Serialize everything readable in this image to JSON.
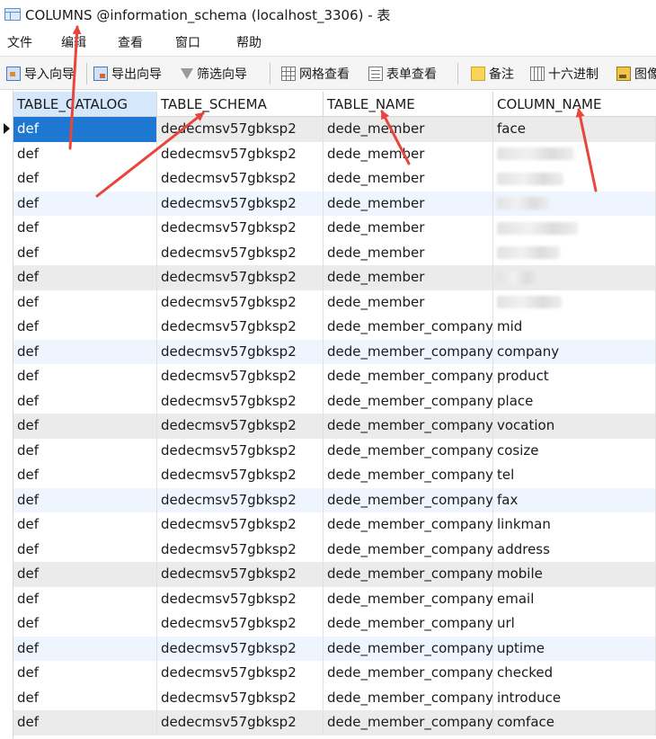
{
  "window": {
    "title": "COLUMNS @information_schema (localhost_3306) - 表",
    "icon": "table-icon"
  },
  "menu": [
    {
      "label": "文件"
    },
    {
      "label": "编辑"
    },
    {
      "label": "查看"
    },
    {
      "label": "窗口"
    },
    {
      "label": "帮助"
    }
  ],
  "toolbar": {
    "import_label": "导入向导",
    "export_label": "导出向导",
    "filter_label": "筛选向导",
    "grid_view_label": "网格查看",
    "form_view_label": "表单查看",
    "note_label": "备注",
    "hex_label": "十六进制",
    "image_label": "图像"
  },
  "columns": [
    "TABLE_CATALOG",
    "TABLE_SCHEMA",
    "TABLE_NAME",
    "COLUMN_NAME"
  ],
  "rows": [
    {
      "catalog": "def",
      "schema": "dedecmsv57gbksp2",
      "table": "dede_member",
      "column": "face"
    },
    {
      "catalog": "def",
      "schema": "dedecmsv57gbksp2",
      "table": "dede_member",
      "column": ""
    },
    {
      "catalog": "def",
      "schema": "dedecmsv57gbksp2",
      "table": "dede_member",
      "column": ""
    },
    {
      "catalog": "def",
      "schema": "dedecmsv57gbksp2",
      "table": "dede_member",
      "column": ""
    },
    {
      "catalog": "def",
      "schema": "dedecmsv57gbksp2",
      "table": "dede_member",
      "column": ""
    },
    {
      "catalog": "def",
      "schema": "dedecmsv57gbksp2",
      "table": "dede_member",
      "column": ""
    },
    {
      "catalog": "def",
      "schema": "dedecmsv57gbksp2",
      "table": "dede_member",
      "column": ""
    },
    {
      "catalog": "def",
      "schema": "dedecmsv57gbksp2",
      "table": "dede_member",
      "column": ""
    },
    {
      "catalog": "def",
      "schema": "dedecmsv57gbksp2",
      "table": "dede_member_company",
      "column": "mid"
    },
    {
      "catalog": "def",
      "schema": "dedecmsv57gbksp2",
      "table": "dede_member_company",
      "column": "company"
    },
    {
      "catalog": "def",
      "schema": "dedecmsv57gbksp2",
      "table": "dede_member_company",
      "column": "product"
    },
    {
      "catalog": "def",
      "schema": "dedecmsv57gbksp2",
      "table": "dede_member_company",
      "column": "place"
    },
    {
      "catalog": "def",
      "schema": "dedecmsv57gbksp2",
      "table": "dede_member_company",
      "column": "vocation"
    },
    {
      "catalog": "def",
      "schema": "dedecmsv57gbksp2",
      "table": "dede_member_company",
      "column": "cosize"
    },
    {
      "catalog": "def",
      "schema": "dedecmsv57gbksp2",
      "table": "dede_member_company",
      "column": "tel"
    },
    {
      "catalog": "def",
      "schema": "dedecmsv57gbksp2",
      "table": "dede_member_company",
      "column": "fax"
    },
    {
      "catalog": "def",
      "schema": "dedecmsv57gbksp2",
      "table": "dede_member_company",
      "column": "linkman"
    },
    {
      "catalog": "def",
      "schema": "dedecmsv57gbksp2",
      "table": "dede_member_company",
      "column": "address"
    },
    {
      "catalog": "def",
      "schema": "dedecmsv57gbksp2",
      "table": "dede_member_company",
      "column": "mobile"
    },
    {
      "catalog": "def",
      "schema": "dedecmsv57gbksp2",
      "table": "dede_member_company",
      "column": "email"
    },
    {
      "catalog": "def",
      "schema": "dedecmsv57gbksp2",
      "table": "dede_member_company",
      "column": "url"
    },
    {
      "catalog": "def",
      "schema": "dedecmsv57gbksp2",
      "table": "dede_member_company",
      "column": "uptime"
    },
    {
      "catalog": "def",
      "schema": "dedecmsv57gbksp2",
      "table": "dede_member_company",
      "column": "checked"
    },
    {
      "catalog": "def",
      "schema": "dedecmsv57gbksp2",
      "table": "dede_member_company",
      "column": "introduce"
    },
    {
      "catalog": "def",
      "schema": "dedecmsv57gbksp2",
      "table": "dede_member_company",
      "column": "comface"
    }
  ],
  "colors": {
    "selection": "#1e78d2",
    "active_header": "#d5e8fb",
    "stripe": "#ebebeb",
    "annotation_arrow": "#e8453c"
  }
}
